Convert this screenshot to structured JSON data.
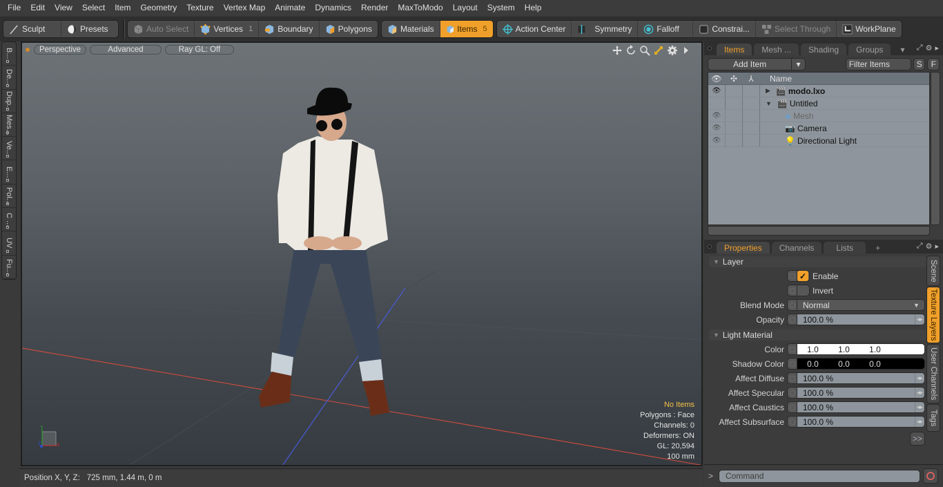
{
  "menu": [
    "File",
    "Edit",
    "View",
    "Select",
    "Item",
    "Geometry",
    "Texture",
    "Vertex Map",
    "Animate",
    "Dynamics",
    "Render",
    "MaxToModo",
    "Layout",
    "System",
    "Help"
  ],
  "toolbar": {
    "sculpt": "Sculpt",
    "presets": "Presets",
    "auto_select": "Auto Select",
    "vertices": "Vertices",
    "vertices_count": "1",
    "boundary": "Boundary",
    "polygons": "Polygons",
    "materials": "Materials",
    "items": "Items",
    "items_count": "5",
    "action_center": "Action Center",
    "symmetry": "Symmetry",
    "falloff": "Falloff",
    "constraints": "Constrai...",
    "select_through": "Select Through",
    "workplane": "WorkPlane"
  },
  "left_tabs": [
    "B...",
    "De...",
    "Dup...",
    "Mes...",
    "Ve...",
    "E...",
    "Pol...",
    "C ...",
    "UV",
    "Fu..."
  ],
  "viewport": {
    "view_mode": "Perspective",
    "shading": "Advanced",
    "raygl": "Ray GL: Off",
    "stats": {
      "selection": "No Items",
      "polygons": "Polygons : Face",
      "channels": "Channels: 0",
      "deformers": "Deformers: ON",
      "gl": "GL: 20,594",
      "scale": "100 mm"
    },
    "axis_colors": {
      "x": "#c03030",
      "y": "#30a030",
      "z": "#3050d0"
    }
  },
  "statusbar": {
    "label": "Position X, Y, Z:",
    "value": "725 mm, 1.44 m, 0 m"
  },
  "items_panel": {
    "tabs": [
      "Items",
      "Mesh ...",
      "Shading",
      "Groups"
    ],
    "active_tab": "Items",
    "add_item": "Add Item",
    "filter_placeholder": "Filter Items",
    "s_btn": "S",
    "f_btn": "F",
    "column_name": "Name",
    "rows": [
      {
        "name": "modo.lxo",
        "bold": true,
        "expander": "collapsed",
        "icon": "scene-icon",
        "visible": true,
        "depth": 0
      },
      {
        "name": "Untitled",
        "bold": false,
        "expander": "expanded",
        "icon": "scene-icon",
        "visible": false,
        "depth": 0
      },
      {
        "name": "Mesh",
        "dim": true,
        "icon": "mesh-icon",
        "visible": true,
        "depth": 1
      },
      {
        "name": "Camera",
        "icon": "camera-icon",
        "visible": true,
        "depth": 1
      },
      {
        "name": "Directional Light",
        "icon": "light-icon",
        "visible": true,
        "depth": 1
      }
    ]
  },
  "properties_panel": {
    "tabs": [
      "Properties",
      "Channels",
      "Lists"
    ],
    "add_tab": "+",
    "active_tab": "Properties",
    "layer_section": "Layer",
    "enable_label": "Enable",
    "enable_checked": true,
    "invert_label": "Invert",
    "invert_checked": false,
    "blend_mode_label": "Blend Mode",
    "blend_mode": "Normal",
    "opacity_label": "Opacity",
    "opacity": "100.0 %",
    "light_material_section": "Light Material",
    "color_label": "Color",
    "color": [
      "1.0",
      "1.0",
      "1.0"
    ],
    "shadow_color_label": "Shadow Color",
    "shadow_color": [
      "0.0",
      "0.0",
      "0.0"
    ],
    "affect_diffuse_label": "Affect Diffuse",
    "affect_diffuse": "100.0 %",
    "affect_specular_label": "Affect Specular",
    "affect_specular": "100.0 %",
    "affect_caustics_label": "Affect Caustics",
    "affect_caustics": "100.0 %",
    "affect_subsurface_label": "Affect Subsurface",
    "affect_subsurface": "100.0 %",
    "more_btn": ">>",
    "side_tabs": [
      "Scene",
      "Texture Layers",
      "User Channels",
      "Tags"
    ],
    "active_side_tab": "Texture Layers"
  },
  "command": {
    "prompt": ">",
    "placeholder": "Command"
  },
  "colors": {
    "accent": "#f0a02a",
    "highlight_text": "#f5c04a"
  }
}
